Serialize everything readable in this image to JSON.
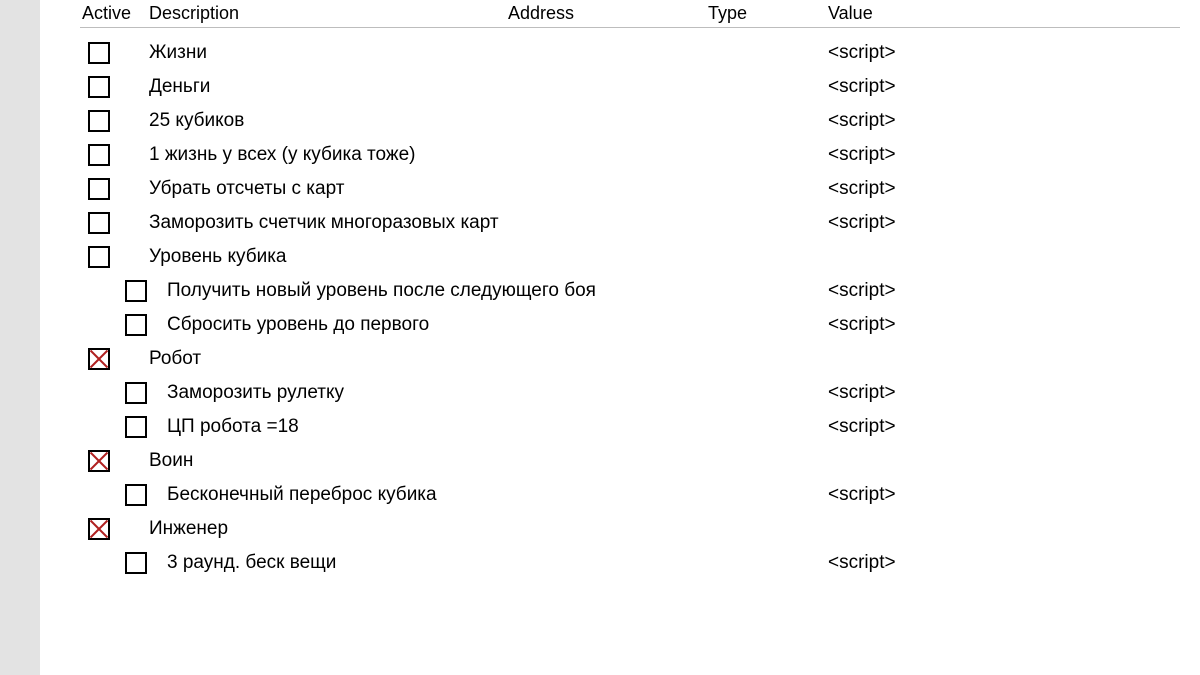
{
  "headers": {
    "active": "Active",
    "description": "Description",
    "address": "Address",
    "type": "Type",
    "value": "Value"
  },
  "rows": [
    {
      "indent": 0,
      "checked": false,
      "description": "Жизни",
      "address": "",
      "type": "",
      "value": "<script>"
    },
    {
      "indent": 0,
      "checked": false,
      "description": "Деньги",
      "address": "",
      "type": "",
      "value": "<script>"
    },
    {
      "indent": 0,
      "checked": false,
      "description": "25 кубиков",
      "address": "",
      "type": "",
      "value": "<script>"
    },
    {
      "indent": 0,
      "checked": false,
      "description": "1 жизнь у всех (у кубика тоже)",
      "address": "",
      "type": "",
      "value": "<script>"
    },
    {
      "indent": 0,
      "checked": false,
      "description": "Убрать отсчеты с карт",
      "address": "",
      "type": "",
      "value": "<script>"
    },
    {
      "indent": 0,
      "checked": false,
      "description": "Заморозить счетчик многоразовых карт",
      "address": "",
      "type": "",
      "value": "<script>"
    },
    {
      "indent": 0,
      "checked": false,
      "description": "Уровень кубика",
      "address": "",
      "type": "",
      "value": ""
    },
    {
      "indent": 1,
      "checked": false,
      "description": "Получить новый уровень после следующего боя",
      "address": "",
      "type": "",
      "value": "<script>"
    },
    {
      "indent": 1,
      "checked": false,
      "description": "Сбросить уровень до первого",
      "address": "",
      "type": "",
      "value": "<script>"
    },
    {
      "indent": 0,
      "checked": true,
      "description": "Робот",
      "address": "",
      "type": "",
      "value": ""
    },
    {
      "indent": 1,
      "checked": false,
      "description": "Заморозить рулетку",
      "address": "",
      "type": "",
      "value": "<script>"
    },
    {
      "indent": 1,
      "checked": false,
      "description": "ЦП робота =18",
      "address": "",
      "type": "",
      "value": "<script>"
    },
    {
      "indent": 0,
      "checked": true,
      "description": "Воин",
      "address": "",
      "type": "",
      "value": ""
    },
    {
      "indent": 1,
      "checked": false,
      "description": "Бесконечный переброс кубика",
      "address": "",
      "type": "",
      "value": "<script>"
    },
    {
      "indent": 0,
      "checked": true,
      "description": "Инженер",
      "address": "",
      "type": "",
      "value": ""
    },
    {
      "indent": 1,
      "checked": false,
      "description": "3 раунд. беск вещи",
      "address": "",
      "type": "",
      "value": "<script>"
    }
  ]
}
